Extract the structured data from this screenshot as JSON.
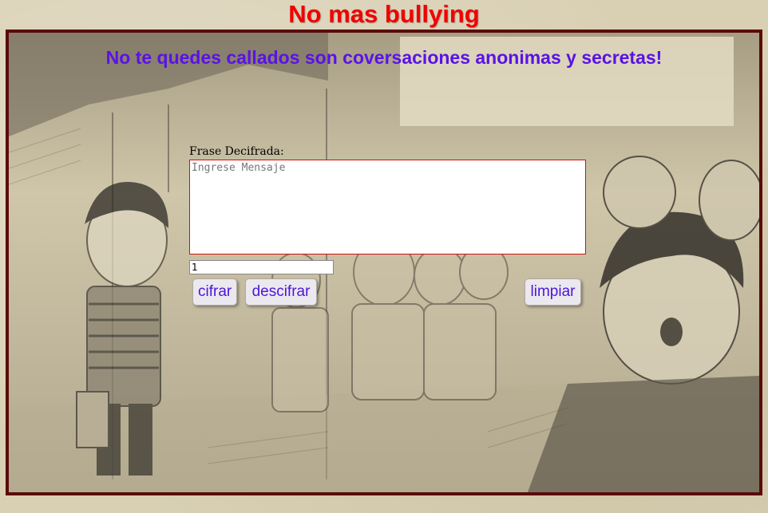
{
  "header": {
    "title": "No mas bullying"
  },
  "banner": {
    "subtitle": "No te quedes callados son coversaciones anonimas y secretas!"
  },
  "form": {
    "label": "Frase Decifrada:",
    "message_placeholder": "Ingrese Mensaje",
    "message_value": "",
    "key_value": "1",
    "cifrar_label": "cifrar",
    "descifrar_label": "descifrar",
    "limpiar_label": "limpiar"
  },
  "colors": {
    "title": "#f00000",
    "subtitle": "#5a12e6",
    "frame_border": "#5a0b0b",
    "button_text": "#4b16d8"
  }
}
